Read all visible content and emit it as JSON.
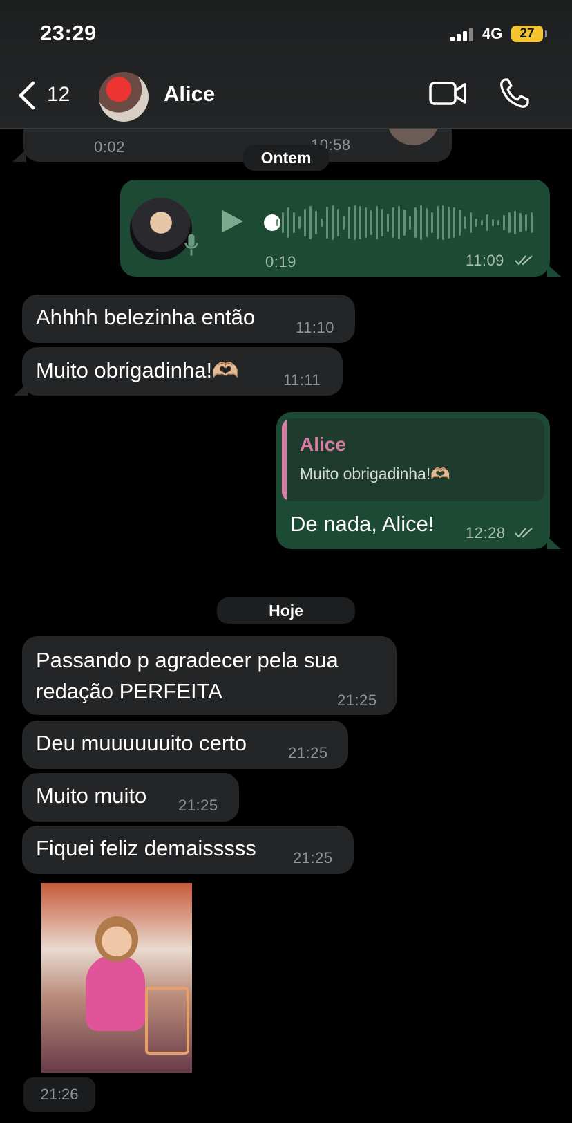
{
  "status_bar": {
    "time": "23:29",
    "network": "4G",
    "battery": "27"
  },
  "header": {
    "back_count": "12",
    "contact_name": "Alice"
  },
  "older_preview": {
    "duration": "0:02",
    "timestamp": "10:58"
  },
  "day_separators": {
    "yesterday": "Ontem",
    "today": "Hoje"
  },
  "voice_message": {
    "duration": "0:19",
    "timestamp": "11:09",
    "progress_fraction": 0
  },
  "messages": [
    {
      "direction": "in",
      "text": "Ahhhh belezinha então",
      "time": "11:10"
    },
    {
      "direction": "in",
      "text": "Muito obrigadinha!🫶🏼",
      "time": "11:11"
    },
    {
      "direction": "out",
      "text": "De nada, Alice!",
      "time": "12:28",
      "reply_to": {
        "author": "Alice",
        "text": "Muito obrigadinha!🫶🏼"
      }
    },
    {
      "direction": "in",
      "text_line1": "Passando p agradecer pela sua",
      "text_line2": "redação PERFEITA",
      "time": "21:25"
    },
    {
      "direction": "in",
      "text": "Deu muuuuuuito certo",
      "time": "21:25"
    },
    {
      "direction": "in",
      "text": "Muito muito",
      "time": "21:25"
    },
    {
      "direction": "in",
      "text": "Fiquei feliz demaisssss",
      "time": "21:25"
    }
  ],
  "gif_message": {
    "time": "21:26"
  },
  "colors": {
    "outgoing": "#1d4a35",
    "incoming": "#232527",
    "quote_accent": "#d97ba4",
    "battery": "#f4c430"
  }
}
